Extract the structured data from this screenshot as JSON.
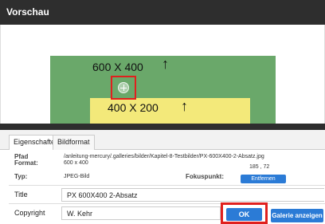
{
  "window": {
    "title": "Vorschau"
  },
  "preview": {
    "outer_label": "600 X 400",
    "inner_label": "400 X 200",
    "outer_color": "#6aa86a",
    "inner_color": "#f3e97a",
    "arrow_symbol": "↑",
    "focus_highlight_color": "#e0201e"
  },
  "tabs": [
    {
      "label": "Eigenschaften",
      "active": true
    },
    {
      "label": "Bildformat",
      "active": false
    }
  ],
  "info": {
    "pfad_label": "Pfad",
    "pfad_value": "/anleitung-mercury/.galleries/bilder/Kapitel-8-Testbilder/PX-600X400-2-Absatz.jpg",
    "format_label": "Format:",
    "format_value": "600 x 400",
    "typ_label": "Typ:",
    "typ_value": "JPEG-Bild",
    "fokus_label": "Fokuspunkt:",
    "fokus_value": "185 , 72",
    "remove_label": "Entfernen"
  },
  "fields": {
    "title_label": "Title",
    "title_value": "PX 600X400 2-Absatz",
    "copyright_label": "Copyright",
    "copyright_value": "W. Kehr"
  },
  "buttons": {
    "ok_label": "OK",
    "gallery_label": "Galerie anzeigen"
  },
  "colors": {
    "accent": "#2b7bd6",
    "titlebar": "#2e2e2e",
    "highlight": "#e0201e"
  }
}
